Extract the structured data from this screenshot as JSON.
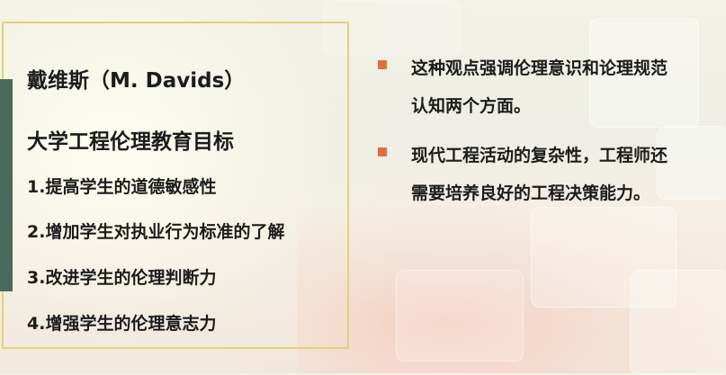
{
  "slide": {
    "title_name": "戴维斯（M. Davids）",
    "title_goals": "大学工程伦理教育目标",
    "goals": [
      "1.提高学生的道德敏感性",
      "2.增加学生对执业行为标准的了解",
      "3.改进学生的伦理判断力",
      "4.增强学生的伦理意志力"
    ],
    "bullets": [
      "这种观点强调伦理意识和论理规范认知两个方面。",
      "现代工程活动的复杂性，工程师还需要培养良好的工程决策能力。"
    ]
  },
  "colors": {
    "accent_bar": "#4a6a5c",
    "box_border": "#e2d27c",
    "bullet_marker": "#e0703a",
    "text": "#1c1c1c"
  }
}
